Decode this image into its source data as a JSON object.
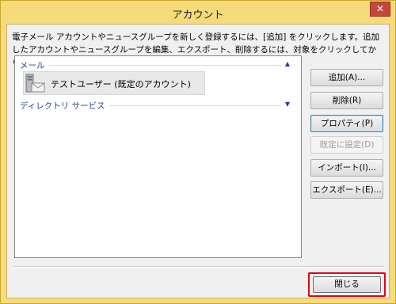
{
  "window": {
    "title": "アカウント",
    "close_glyph": "✕"
  },
  "description": "電子メール アカウントやニュースグループを新しく登録するには、[追加] をクリックします。追加したアカウントやニュースグループを編集、エクスポート、削除するには、対象をクリックしてから、希望の動作をクリックします。",
  "list": {
    "groups": [
      {
        "label": "メール",
        "chevron": "▲",
        "icon": "chevron-up-icon"
      },
      {
        "label": "ディレクトリ サービス",
        "chevron": "▼",
        "icon": "chevron-down-icon"
      }
    ],
    "account": {
      "label": "テストユーザー (既定のアカウント)",
      "icon": "mail-account-icon"
    }
  },
  "buttons": {
    "add": "追加(A)...",
    "delete": "削除(R)",
    "properties": "プロパティ(P)",
    "set_default": "既定に設定(D)",
    "import": "インポート(I)...",
    "export": "エクスポート(E)...",
    "close": "閉じる"
  },
  "colors": {
    "title_bar": "#f5db7a",
    "close_button": "#c7463a",
    "group_header": "#1e3f9e",
    "highlight_frame": "#e60012"
  }
}
